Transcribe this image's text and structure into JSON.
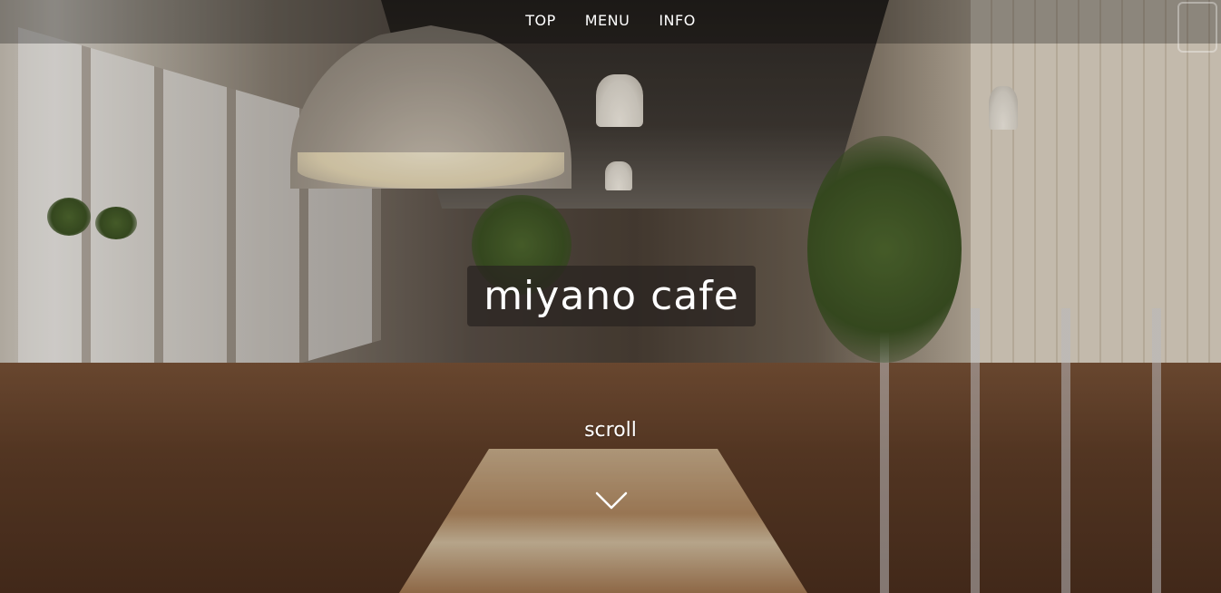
{
  "nav": {
    "items": [
      {
        "label": "TOP"
      },
      {
        "label": "MENU"
      },
      {
        "label": "INFO"
      }
    ]
  },
  "hero": {
    "title": "miyano cafe",
    "scroll_label": "scroll",
    "scroll_icon": "chevron-down-icon",
    "background": "cafe-interior-photo"
  },
  "colors": {
    "text": "#ffffff",
    "nav_bar": "rgba(0,0,0,0.28)",
    "title_box": "rgba(40,35,32,0.72)"
  }
}
